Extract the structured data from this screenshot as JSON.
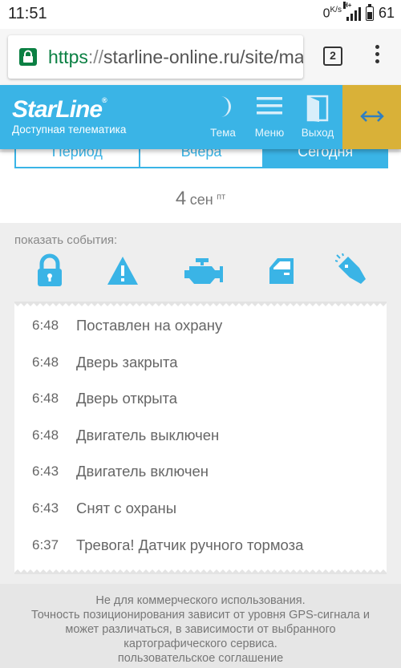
{
  "status_bar": {
    "time": "11:51",
    "net_speed": "0",
    "net_unit": "K/s",
    "signal_type": "H+",
    "battery": "61"
  },
  "browser": {
    "url_scheme": "https",
    "url_sep": "://",
    "url_rest": "starline-online.ru/site/ma",
    "tab_count": "2",
    "lock_icon": "lock-icon",
    "menu_icon": "overflow-menu-icon"
  },
  "header": {
    "brand": "StarLine",
    "trademark": "®",
    "tagline": "Доступная телематика",
    "theme_label": "Тема",
    "menu_label": "Меню",
    "exit_label": "Выход",
    "expand_icon": "expand-arrows-icon",
    "colors": {
      "primary": "#3ab4e6",
      "accent": "#d9b138"
    }
  },
  "period_tabs": [
    "Период",
    "Вчера",
    "Сегодня"
  ],
  "date": {
    "day": "4",
    "month": "сен",
    "weekday": "пт"
  },
  "filters": {
    "label": "показать события:",
    "icons": [
      "lock-icon",
      "warning-icon",
      "engine-icon",
      "door-icon",
      "hand-brake-icon"
    ]
  },
  "events": [
    {
      "time": "6:48",
      "text": "Поставлен на охрану"
    },
    {
      "time": "6:48",
      "text": "Дверь закрыта"
    },
    {
      "time": "6:48",
      "text": "Дверь открыта"
    },
    {
      "time": "6:48",
      "text": "Двигатель выключен"
    },
    {
      "time": "6:43",
      "text": "Двигатель включен"
    },
    {
      "time": "6:43",
      "text": "Снят с охраны"
    },
    {
      "time": "6:37",
      "text": "Тревога! Датчик ручного тормоза"
    }
  ],
  "footer": {
    "line1": "Не для коммерческого использования.",
    "line2": "Точность позиционирования зависит от уровня GPS-сигнала и",
    "line3": "может различаться, в зависимости от выбранного",
    "line4": "картографического сервиса.",
    "link": "пользовательское соглашение"
  }
}
